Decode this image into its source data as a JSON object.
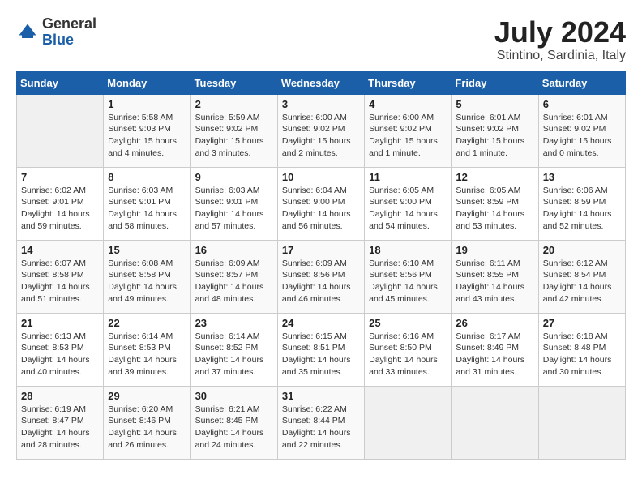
{
  "header": {
    "logo_general": "General",
    "logo_blue": "Blue",
    "month_title": "July 2024",
    "location": "Stintino, Sardinia, Italy"
  },
  "days_of_week": [
    "Sunday",
    "Monday",
    "Tuesday",
    "Wednesday",
    "Thursday",
    "Friday",
    "Saturday"
  ],
  "weeks": [
    [
      {
        "day": "",
        "info": ""
      },
      {
        "day": "1",
        "info": "Sunrise: 5:58 AM\nSunset: 9:03 PM\nDaylight: 15 hours\nand 4 minutes."
      },
      {
        "day": "2",
        "info": "Sunrise: 5:59 AM\nSunset: 9:02 PM\nDaylight: 15 hours\nand 3 minutes."
      },
      {
        "day": "3",
        "info": "Sunrise: 6:00 AM\nSunset: 9:02 PM\nDaylight: 15 hours\nand 2 minutes."
      },
      {
        "day": "4",
        "info": "Sunrise: 6:00 AM\nSunset: 9:02 PM\nDaylight: 15 hours\nand 1 minute."
      },
      {
        "day": "5",
        "info": "Sunrise: 6:01 AM\nSunset: 9:02 PM\nDaylight: 15 hours\nand 1 minute."
      },
      {
        "day": "6",
        "info": "Sunrise: 6:01 AM\nSunset: 9:02 PM\nDaylight: 15 hours\nand 0 minutes."
      }
    ],
    [
      {
        "day": "7",
        "info": "Sunrise: 6:02 AM\nSunset: 9:01 PM\nDaylight: 14 hours\nand 59 minutes."
      },
      {
        "day": "8",
        "info": "Sunrise: 6:03 AM\nSunset: 9:01 PM\nDaylight: 14 hours\nand 58 minutes."
      },
      {
        "day": "9",
        "info": "Sunrise: 6:03 AM\nSunset: 9:01 PM\nDaylight: 14 hours\nand 57 minutes."
      },
      {
        "day": "10",
        "info": "Sunrise: 6:04 AM\nSunset: 9:00 PM\nDaylight: 14 hours\nand 56 minutes."
      },
      {
        "day": "11",
        "info": "Sunrise: 6:05 AM\nSunset: 9:00 PM\nDaylight: 14 hours\nand 54 minutes."
      },
      {
        "day": "12",
        "info": "Sunrise: 6:05 AM\nSunset: 8:59 PM\nDaylight: 14 hours\nand 53 minutes."
      },
      {
        "day": "13",
        "info": "Sunrise: 6:06 AM\nSunset: 8:59 PM\nDaylight: 14 hours\nand 52 minutes."
      }
    ],
    [
      {
        "day": "14",
        "info": "Sunrise: 6:07 AM\nSunset: 8:58 PM\nDaylight: 14 hours\nand 51 minutes."
      },
      {
        "day": "15",
        "info": "Sunrise: 6:08 AM\nSunset: 8:58 PM\nDaylight: 14 hours\nand 49 minutes."
      },
      {
        "day": "16",
        "info": "Sunrise: 6:09 AM\nSunset: 8:57 PM\nDaylight: 14 hours\nand 48 minutes."
      },
      {
        "day": "17",
        "info": "Sunrise: 6:09 AM\nSunset: 8:56 PM\nDaylight: 14 hours\nand 46 minutes."
      },
      {
        "day": "18",
        "info": "Sunrise: 6:10 AM\nSunset: 8:56 PM\nDaylight: 14 hours\nand 45 minutes."
      },
      {
        "day": "19",
        "info": "Sunrise: 6:11 AM\nSunset: 8:55 PM\nDaylight: 14 hours\nand 43 minutes."
      },
      {
        "day": "20",
        "info": "Sunrise: 6:12 AM\nSunset: 8:54 PM\nDaylight: 14 hours\nand 42 minutes."
      }
    ],
    [
      {
        "day": "21",
        "info": "Sunrise: 6:13 AM\nSunset: 8:53 PM\nDaylight: 14 hours\nand 40 minutes."
      },
      {
        "day": "22",
        "info": "Sunrise: 6:14 AM\nSunset: 8:53 PM\nDaylight: 14 hours\nand 39 minutes."
      },
      {
        "day": "23",
        "info": "Sunrise: 6:14 AM\nSunset: 8:52 PM\nDaylight: 14 hours\nand 37 minutes."
      },
      {
        "day": "24",
        "info": "Sunrise: 6:15 AM\nSunset: 8:51 PM\nDaylight: 14 hours\nand 35 minutes."
      },
      {
        "day": "25",
        "info": "Sunrise: 6:16 AM\nSunset: 8:50 PM\nDaylight: 14 hours\nand 33 minutes."
      },
      {
        "day": "26",
        "info": "Sunrise: 6:17 AM\nSunset: 8:49 PM\nDaylight: 14 hours\nand 31 minutes."
      },
      {
        "day": "27",
        "info": "Sunrise: 6:18 AM\nSunset: 8:48 PM\nDaylight: 14 hours\nand 30 minutes."
      }
    ],
    [
      {
        "day": "28",
        "info": "Sunrise: 6:19 AM\nSunset: 8:47 PM\nDaylight: 14 hours\nand 28 minutes."
      },
      {
        "day": "29",
        "info": "Sunrise: 6:20 AM\nSunset: 8:46 PM\nDaylight: 14 hours\nand 26 minutes."
      },
      {
        "day": "30",
        "info": "Sunrise: 6:21 AM\nSunset: 8:45 PM\nDaylight: 14 hours\nand 24 minutes."
      },
      {
        "day": "31",
        "info": "Sunrise: 6:22 AM\nSunset: 8:44 PM\nDaylight: 14 hours\nand 22 minutes."
      },
      {
        "day": "",
        "info": ""
      },
      {
        "day": "",
        "info": ""
      },
      {
        "day": "",
        "info": ""
      }
    ]
  ]
}
